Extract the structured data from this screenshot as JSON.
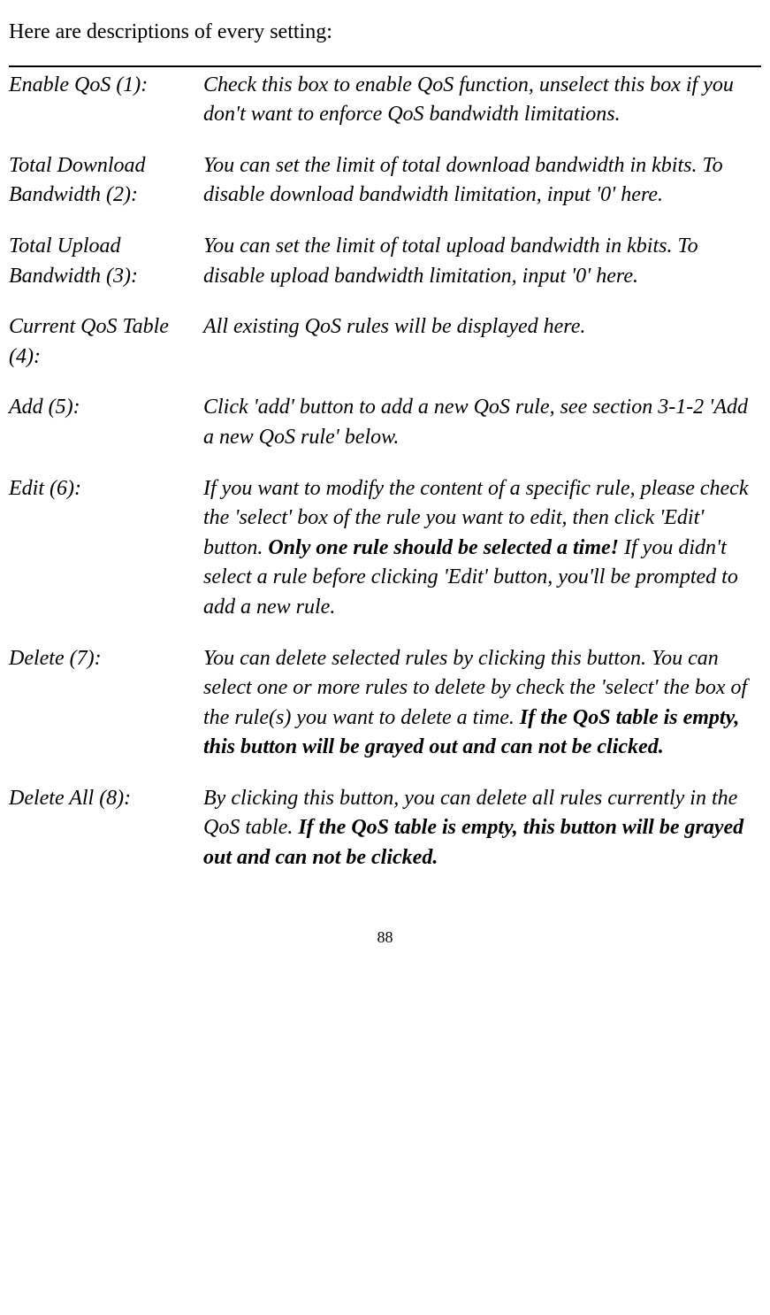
{
  "intro": "Here are descriptions of every setting:",
  "entries": [
    {
      "label": "Enable QoS (1):",
      "desc_parts": [
        {
          "text": "Check this box to enable QoS function, unselect this box if you don't want to enforce QoS bandwidth limitations.",
          "bold": false
        }
      ]
    },
    {
      "label": "Total Download Bandwidth (2):",
      "desc_parts": [
        {
          "text": "You can set the limit of total download bandwidth in kbits. To disable download bandwidth limitation, input '0' here.",
          "bold": false
        }
      ]
    },
    {
      "label": "Total Upload Bandwidth (3):",
      "desc_parts": [
        {
          "text": "You can set the limit of total upload bandwidth in kbits. To disable upload bandwidth limitation, input '0' here.",
          "bold": false
        }
      ]
    },
    {
      "label": "Current QoS Table (4):",
      "desc_parts": [
        {
          "text": "All existing QoS rules will be displayed here.",
          "bold": false
        }
      ]
    },
    {
      "label": "Add (5):",
      "desc_parts": [
        {
          "text": "Click 'add' button to add a new QoS rule, see section 3-1-2 'Add a new QoS rule' below.",
          "bold": false
        }
      ]
    },
    {
      "label": "Edit (6):",
      "desc_parts": [
        {
          "text": "If you want to modify the content of a specific rule, please check the 'select' box of the rule you want to edit, then click 'Edit' button. ",
          "bold": false
        },
        {
          "text": "Only one rule should be selected a time!",
          "bold": true
        },
        {
          "text": " If you didn't select a rule before clicking 'Edit' button, you'll be prompted to add a new rule.",
          "bold": false
        }
      ]
    },
    {
      "label": "Delete (7):",
      "desc_parts": [
        {
          "text": "You can delete selected rules by clicking this button. You can select one or more rules to delete by check the 'select' the box of the rule(s) you want to delete a time. ",
          "bold": false
        },
        {
          "text": "If the QoS table is empty, this button will be grayed out and can not be clicked.",
          "bold": true
        }
      ]
    },
    {
      "label": "Delete All (8):",
      "desc_parts": [
        {
          "text": "By clicking this button, you can delete all rules currently in the QoS table. ",
          "bold": false
        },
        {
          "text": "If the QoS table is empty, this button will be grayed out and can not be clicked.",
          "bold": true
        }
      ]
    }
  ],
  "page_number": "88"
}
